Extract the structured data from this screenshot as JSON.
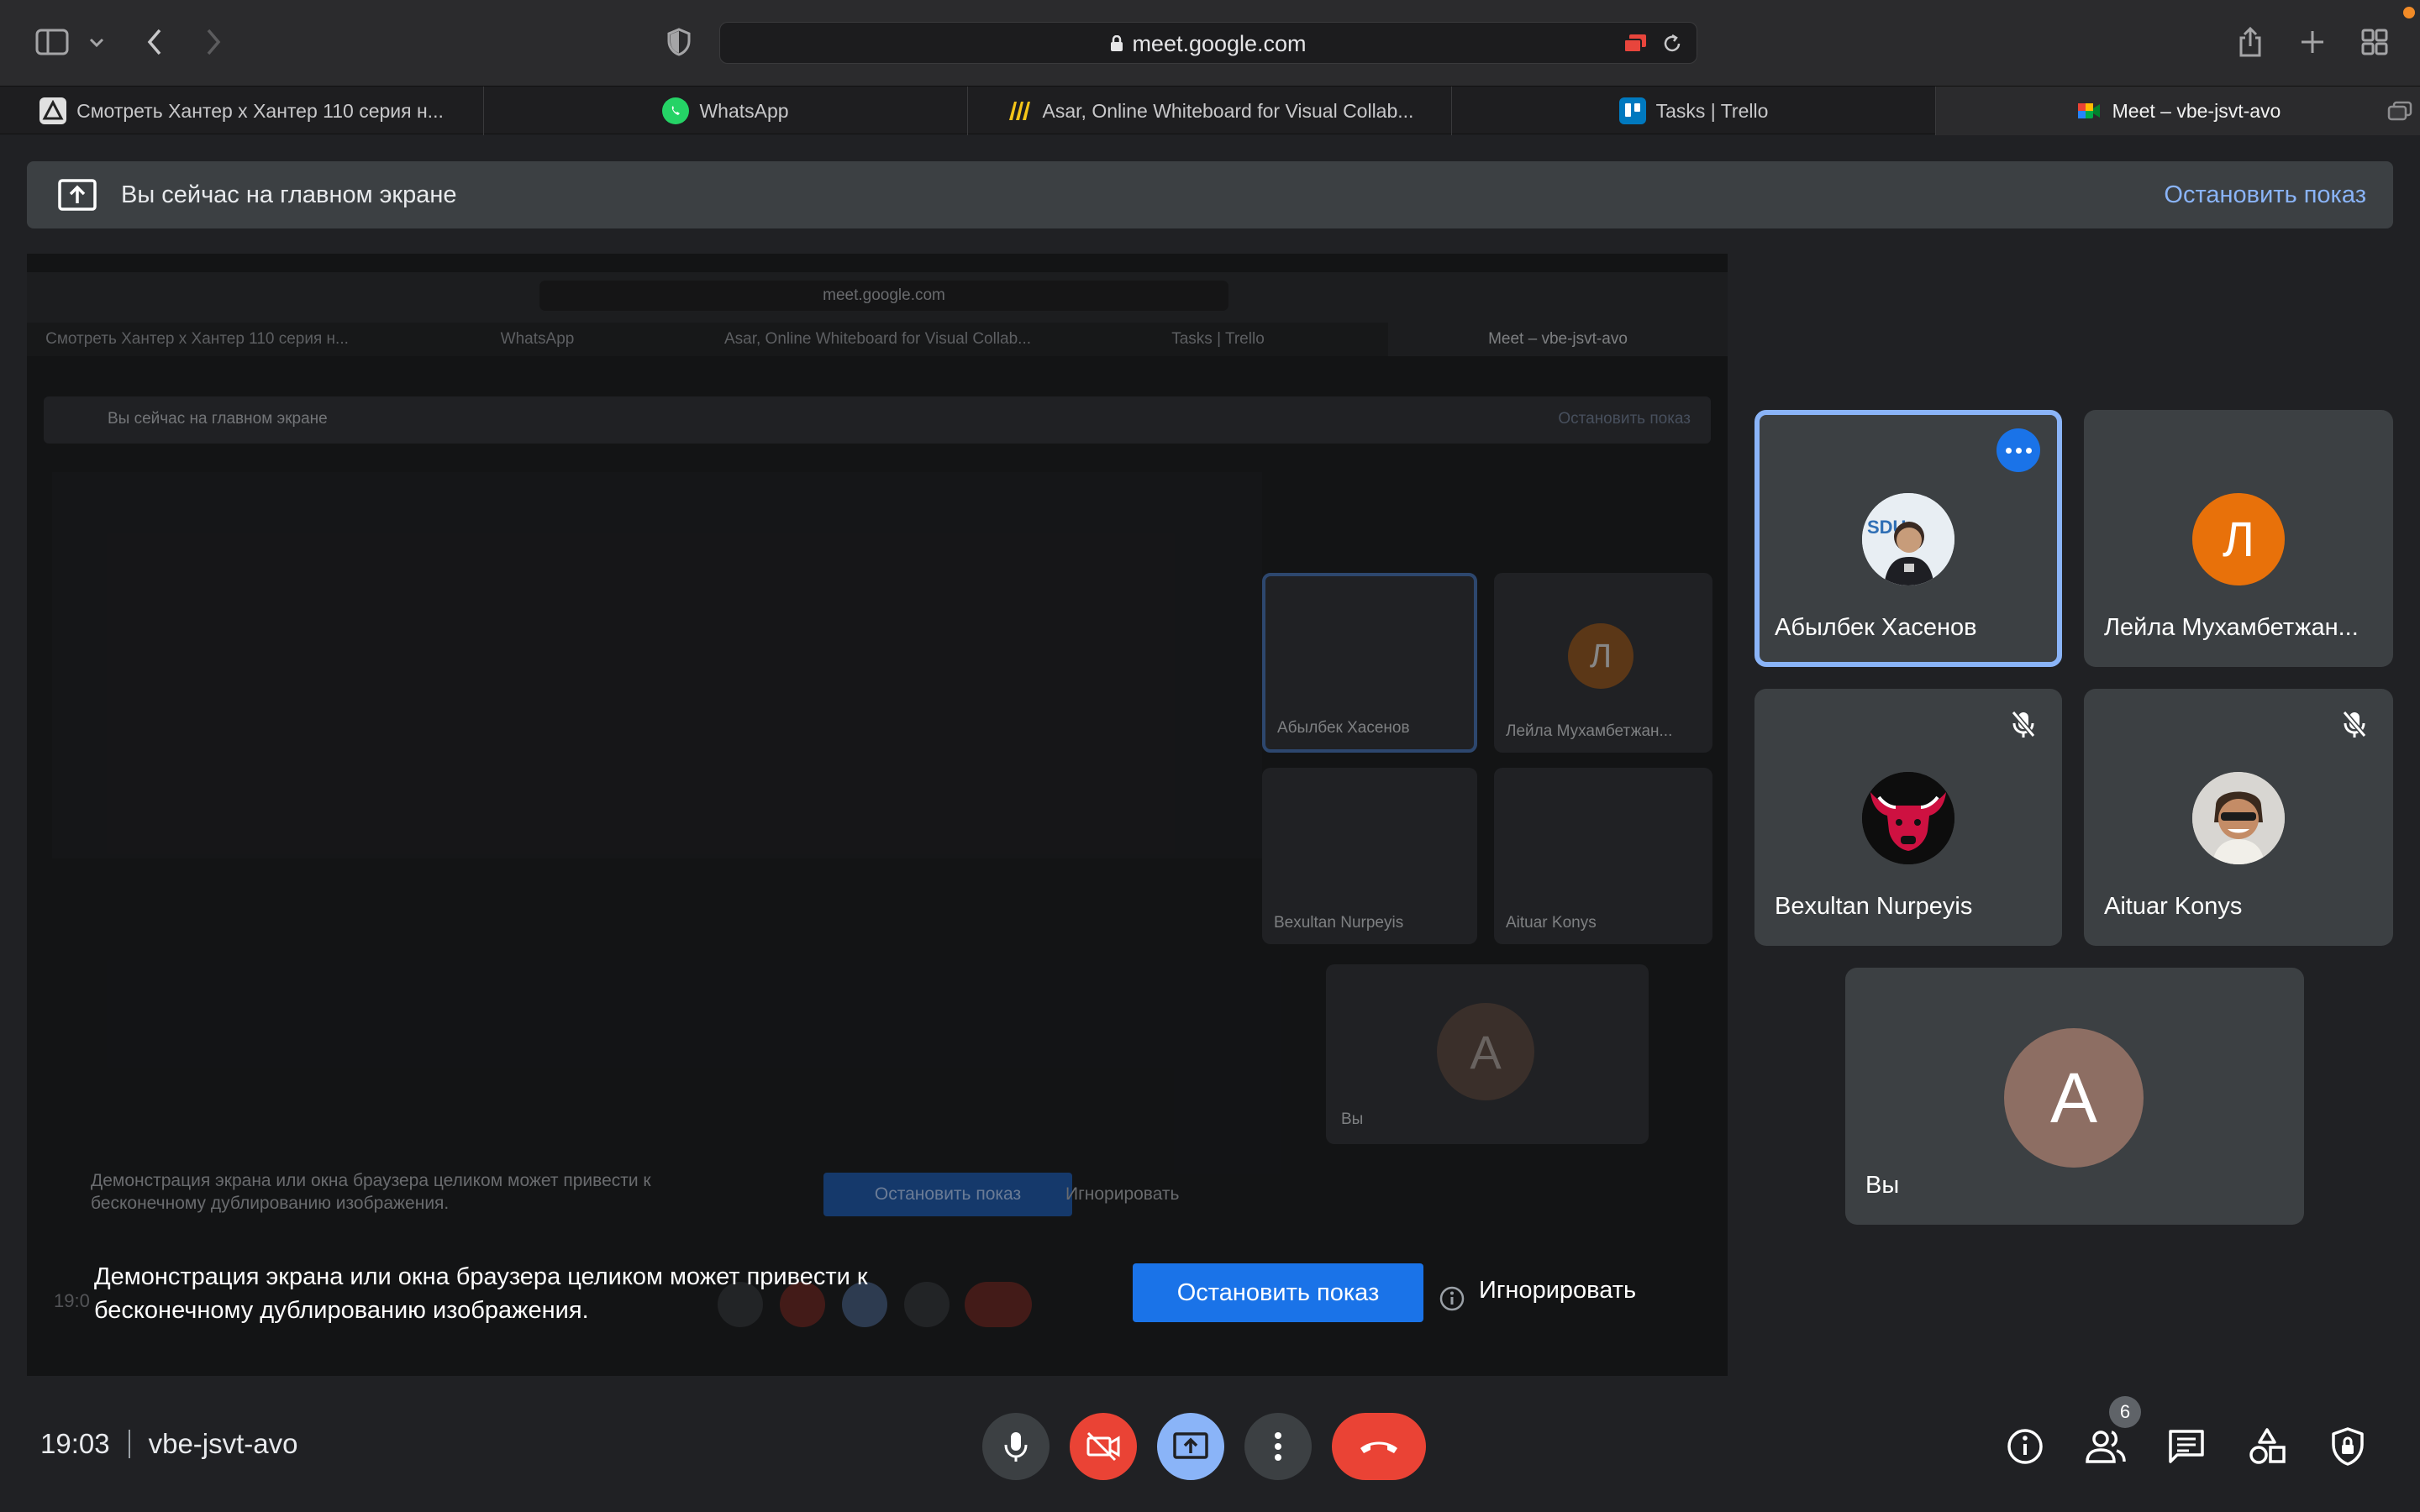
{
  "browser": {
    "url": "meet.google.com",
    "tabs": [
      {
        "label": "Смотреть Хантер х Хантер 110 серия н...",
        "icon": "anime-site-icon",
        "active": false
      },
      {
        "label": "WhatsApp",
        "icon": "whatsapp-icon",
        "active": false
      },
      {
        "label": "Asar, Online Whiteboard for Visual Collab...",
        "icon": "asar-icon",
        "active": false
      },
      {
        "label": "Tasks | Trello",
        "icon": "trello-icon",
        "active": false
      },
      {
        "label": "Meet – vbe-jsvt-avo",
        "icon": "google-meet-icon",
        "active": true
      }
    ]
  },
  "banner": {
    "text": "Вы сейчас на главном экране",
    "stop_label": "Остановить показ"
  },
  "presentation_preview": {
    "url": "meet.google.com",
    "tabs": [
      "Смотреть Хантер х Хантер 110 серия н...",
      "WhatsApp",
      "Asar, Online Whiteboard for Visual Collab...",
      "Tasks | Trello",
      "Meet – vbe-jsvt-avo"
    ],
    "banner_text": "Вы сейчас на главном экране",
    "banner_stop": "Остановить показ",
    "tiles": [
      "Абылбек Хасенов",
      "Лейла Мухамбетжан...",
      "Bexultan Nurpeyis",
      "Aituar Konys",
      "Вы"
    ],
    "avatar_letters": [
      "Л",
      "A"
    ],
    "warning": "Демонстрация экрана или окна браузера целиком может привести к бесконечному дублированию изображения.",
    "stop_button": "Остановить показ",
    "ignore": "Игнорировать",
    "time": "19:0"
  },
  "participants": [
    {
      "name": "Абылбек Хасенов",
      "avatar_type": "photo",
      "speaking": true,
      "muted": false
    },
    {
      "name": "Лейла Мухамбетжан...",
      "avatar_type": "letter",
      "letter": "Л",
      "color": "#e8710a",
      "muted": false
    },
    {
      "name": "Bexultan Nurpeyis",
      "avatar_type": "bulls-logo",
      "muted": true
    },
    {
      "name": "Aituar Konys",
      "avatar_type": "photo",
      "muted": true
    },
    {
      "name": "Вы",
      "avatar_type": "letter",
      "letter": "A",
      "color": "#8d6e63"
    }
  ],
  "warning": {
    "text": "Демонстрация экрана или окна браузера целиком может привести к бесконечному дублированию изображения.",
    "stop_label": "Остановить показ",
    "ignore_label": "Игнорировать"
  },
  "bottom_bar": {
    "time": "19:03",
    "meeting_code": "vbe-jsvt-avo",
    "people_count": "6"
  },
  "colors": {
    "background": "#202124",
    "tile": "#3c4043",
    "accent_blue": "#8ab4f8",
    "button_blue": "#1a73e8",
    "red": "#ea4335"
  }
}
